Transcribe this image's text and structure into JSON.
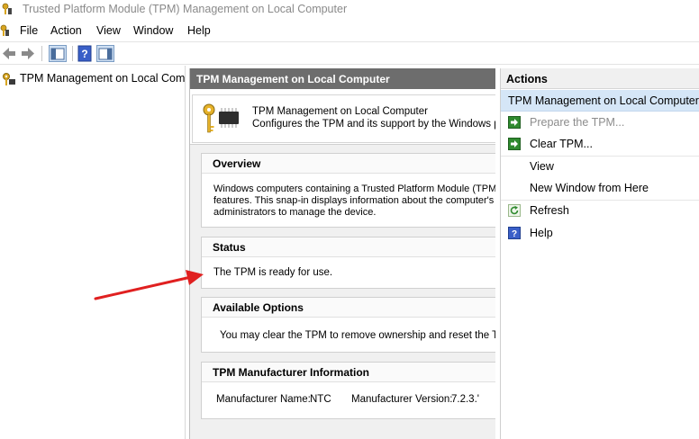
{
  "window": {
    "title": "Trusted Platform Module (TPM) Management on Local Computer"
  },
  "menu": {
    "items": [
      "File",
      "Action",
      "View",
      "Window",
      "Help"
    ]
  },
  "tree": {
    "root_label": "TPM Management on Local Comp"
  },
  "center": {
    "header": "TPM Management on Local Computer",
    "intro_title": "TPM Management on Local Computer",
    "intro_desc": "Configures the TPM and its support by the Windows platfo",
    "overview": {
      "heading": "Overview",
      "lines": [
        "Windows computers containing a Trusted Platform Module (TPM) p",
        "features. This snap-in displays information about the computer's TF",
        "administrators to manage the device."
      ]
    },
    "status": {
      "heading": "Status",
      "text": "The TPM is ready for use."
    },
    "options": {
      "heading": "Available Options",
      "text": "You may clear the TPM to remove ownership and reset the TPM t"
    },
    "manufacturer": {
      "heading": "TPM Manufacturer Information",
      "name_label": "Manufacturer Name:",
      "name_value": "NTC",
      "version_label": "Manufacturer Version:",
      "version_value": "7.2.3.'"
    }
  },
  "actions": {
    "header": "Actions",
    "group_title": "TPM Management on Local Computer",
    "items": [
      {
        "label": "Prepare the TPM...",
        "icon": "green-arrow-icon",
        "enabled": false
      },
      {
        "label": "Clear TPM...",
        "icon": "green-arrow-icon",
        "enabled": true
      },
      {
        "label": "View",
        "icon": "",
        "enabled": true
      },
      {
        "label": "New Window from Here",
        "icon": "",
        "enabled": true
      },
      {
        "label": "Refresh",
        "icon": "refresh-icon",
        "enabled": true
      },
      {
        "label": "Help",
        "icon": "help-icon",
        "enabled": true
      }
    ]
  },
  "colors": {
    "header_gray": "#6d6d6d",
    "selection_blue": "#d5e6f7",
    "annotation_red": "#e02020",
    "action_green": "#2f8a2f",
    "help_blue": "#3a5fc8"
  }
}
